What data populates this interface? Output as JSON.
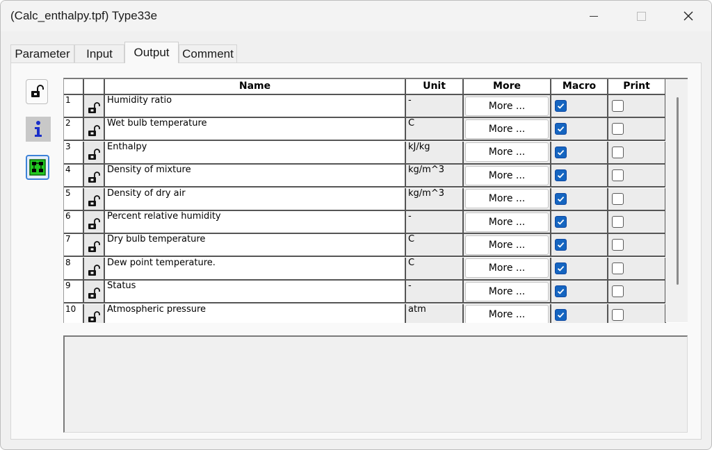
{
  "window": {
    "title": "(Calc_enthalpy.tpf) Type33e"
  },
  "tabs": [
    {
      "label": "Parameter"
    },
    {
      "label": "Input"
    },
    {
      "label": "Output"
    },
    {
      "label": "Comment"
    }
  ],
  "active_tab": "Output",
  "side_buttons": [
    "lock-icon",
    "info-icon",
    "diagram-icon"
  ],
  "grid": {
    "headers": {
      "name": "Name",
      "unit": "Unit",
      "more": "More",
      "macro": "Macro",
      "print": "Print"
    },
    "rows": [
      {
        "num": "1",
        "name": "Humidity ratio",
        "unit": "-",
        "more": "More ...",
        "macro": true,
        "print": false
      },
      {
        "num": "2",
        "name": "Wet bulb temperature",
        "unit": "C",
        "more": "More ...",
        "macro": true,
        "print": false
      },
      {
        "num": "3",
        "name": "Enthalpy",
        "unit": "kJ/kg",
        "more": "More ...",
        "macro": true,
        "print": false
      },
      {
        "num": "4",
        "name": "Density of mixture",
        "unit": "kg/m^3",
        "more": "More ...",
        "macro": true,
        "print": false
      },
      {
        "num": "5",
        "name": "Density of dry air",
        "unit": "kg/m^3",
        "more": "More ...",
        "macro": true,
        "print": false
      },
      {
        "num": "6",
        "name": "Percent relative humidity",
        "unit": "-",
        "more": "More ...",
        "macro": true,
        "print": false
      },
      {
        "num": "7",
        "name": "Dry bulb temperature",
        "unit": "C",
        "more": "More ...",
        "macro": true,
        "print": false
      },
      {
        "num": "8",
        "name": "Dew point temperature.",
        "unit": "C",
        "more": "More ...",
        "macro": true,
        "print": false
      },
      {
        "num": "9",
        "name": "Status",
        "unit": "-",
        "more": "More ...",
        "macro": true,
        "print": false
      },
      {
        "num": "10",
        "name": "Atmospheric pressure",
        "unit": "atm",
        "more": "More ...",
        "macro": true,
        "print": false
      }
    ]
  },
  "colors": {
    "checkbox_checked": "#1565c0",
    "active_tab_bg": "#f9f9f9"
  }
}
